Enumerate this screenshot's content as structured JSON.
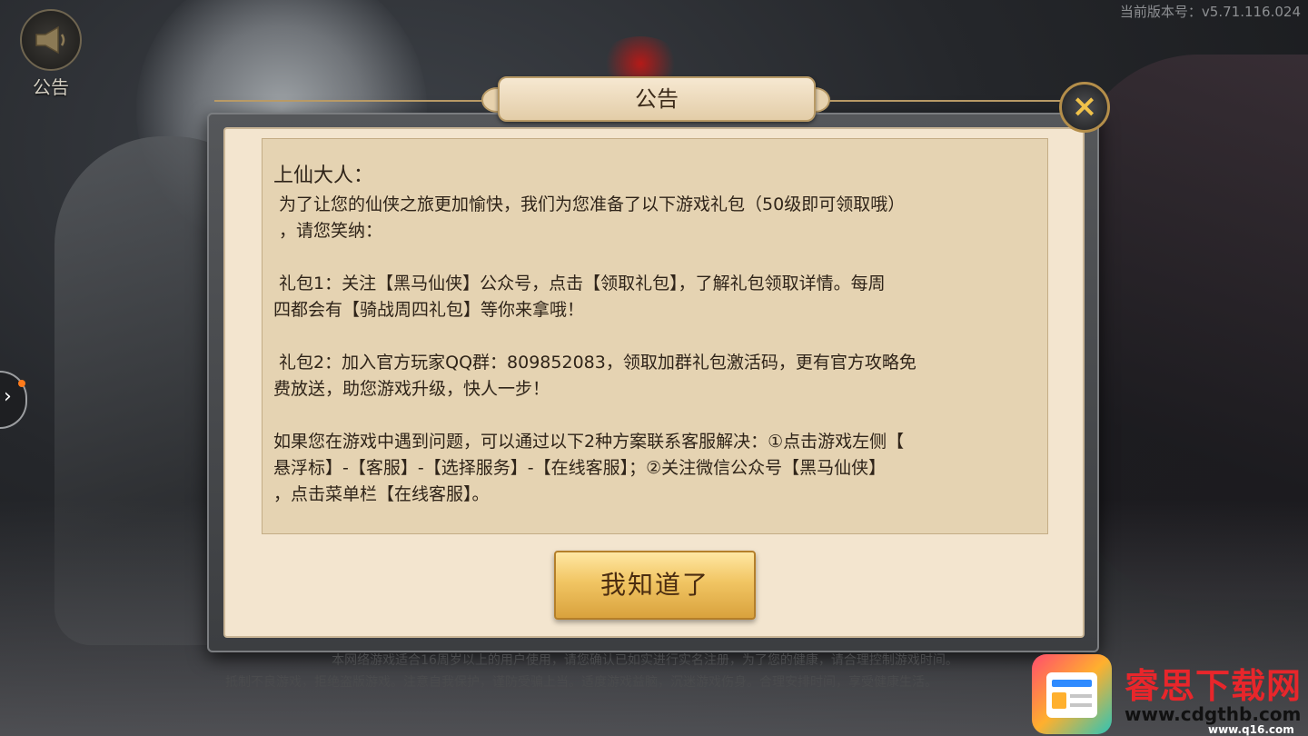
{
  "version_text": "当前版本号：v5.71.116.024",
  "notice_button": {
    "label": "公告",
    "icon": "megaphone-icon"
  },
  "side_tab": {
    "icon": "chevron-right-icon",
    "badge_color": "#ff7a1a"
  },
  "dialog": {
    "title": "公告",
    "close_icon": "close-icon",
    "greeting": "上仙大人：",
    "paragraphs": [
      " 为了让您的仙侠之旅更加愉快，我们为您准备了以下游戏礼包（50级即可领取哦）\n ，请您笑纳：",
      " 礼包1：关注【黑马仙侠】公众号，点击【领取礼包】，了解礼包领取详情。每周\n四都会有【骑战周四礼包】等你来拿哦！",
      " 礼包2：加入官方玩家QQ群：809852083，领取加群礼包激活码，更有官方攻略免\n费放送，助您游戏升级，快人一步！",
      "如果您在游戏中遇到问题，可以通过以下2种方案联系客服解决：①点击游戏左侧【\n悬浮标】-【客服】-【选择服务】-【在线客服】；②关注微信公众号【黑马仙侠】\n，点击菜单栏【在线客服】。"
    ],
    "confirm_button": "我知道了"
  },
  "footer": {
    "line1": "本网络游戏适合16周岁以上的用户使用，请您确认已如实进行实名注册，为了您的健康，请合理控制游戏时间。",
    "line2": "抵制不良游戏，拒绝盗版游戏。注意自我保护，谨防受骗上当。适度游戏益脑，沉迷游戏伤身。合理安排时间，享受健康生活。"
  },
  "watermark": {
    "name": "睿思下载网",
    "url": "www.cdgthb.com",
    "url2": "www.q16.com"
  },
  "colors": {
    "accent_gold": "#f1c563",
    "panel_bg": "#f3e5cf",
    "text_dark": "#2f2419"
  }
}
